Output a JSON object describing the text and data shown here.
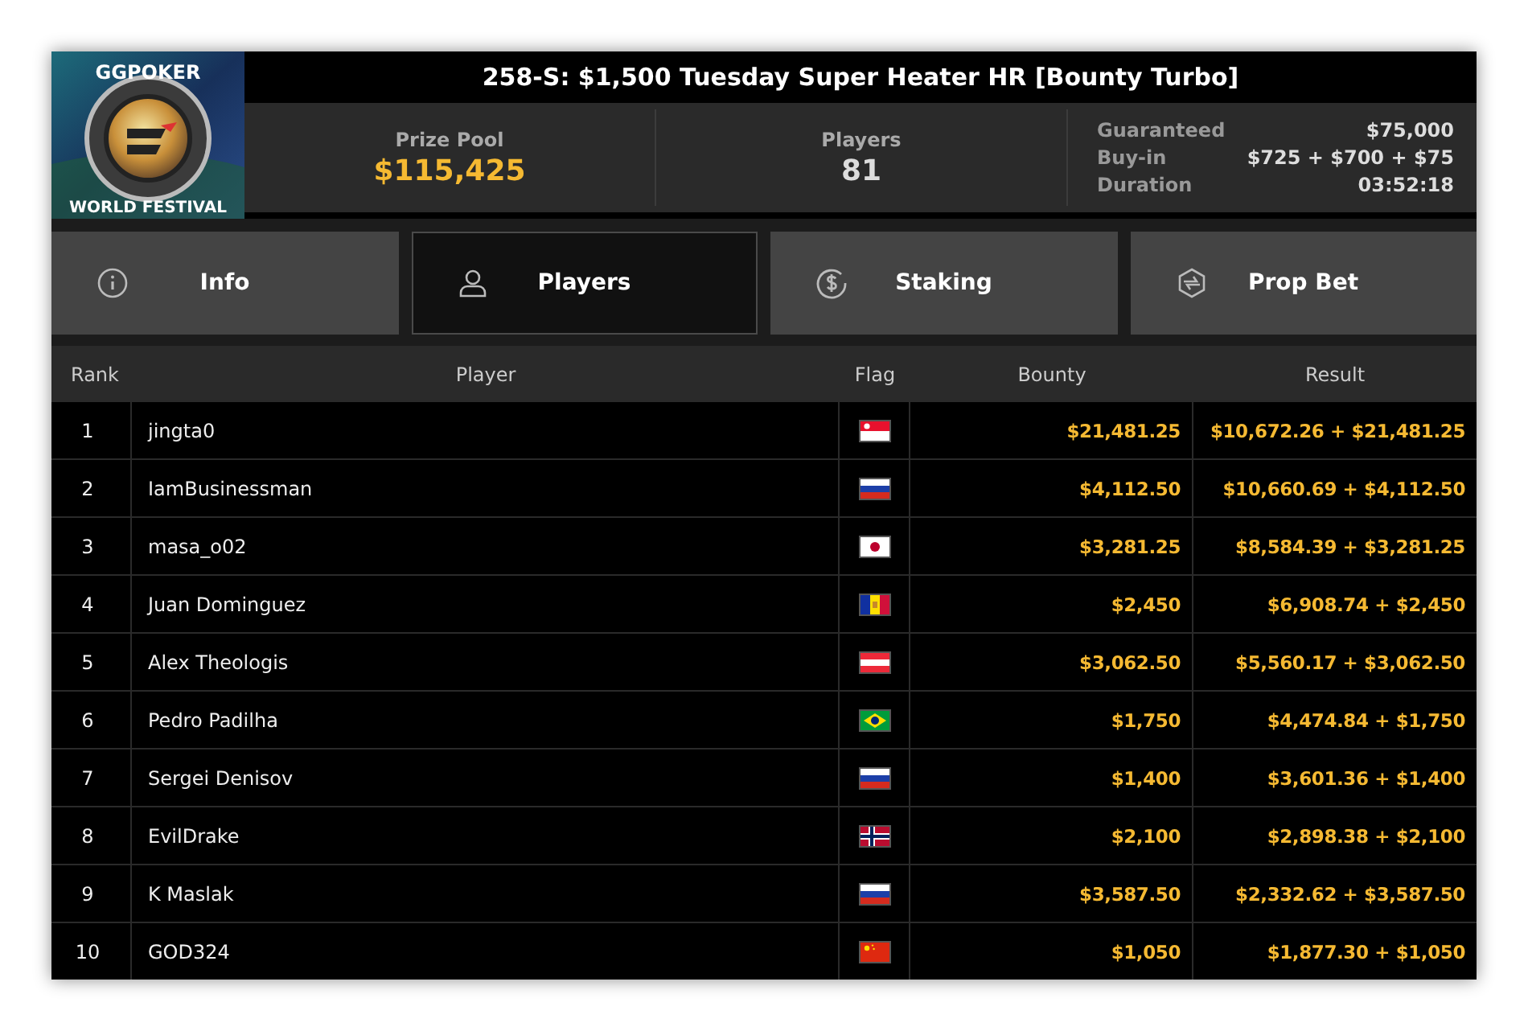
{
  "logo": {
    "top_text": "GGPOKER",
    "bottom_text": "WORLD FESTIVAL"
  },
  "title": "258-S: $1,500 Tuesday Super Heater HR [Bounty Turbo]",
  "stats": [
    {
      "label": "Prize Pool",
      "value": "$115,425",
      "kind": "gold"
    },
    {
      "label": "Players",
      "value": "81",
      "kind": "plain"
    }
  ],
  "details": [
    {
      "label": "Guaranteed",
      "value": "$75,000"
    },
    {
      "label": "Buy-in",
      "value": "$725 + $700 + $75"
    },
    {
      "label": "Duration",
      "value": "03:52:18"
    }
  ],
  "tabs": [
    {
      "label": "Info",
      "kind": "info",
      "selected": false
    },
    {
      "label": "Players",
      "kind": "person",
      "selected": true
    },
    {
      "label": "Staking",
      "kind": "dollar",
      "selected": false
    },
    {
      "label": "Prop Bet",
      "kind": "propbet",
      "selected": false
    }
  ],
  "table": {
    "columns": [
      "Rank",
      "Player",
      "Flag",
      "Bounty",
      "Result"
    ],
    "rows": [
      {
        "rank": "1",
        "player": "jingta0",
        "flag": {
          "kind": "singapore"
        },
        "bounty": "$21,481.25",
        "result": "$10,672.26 + $21,481.25"
      },
      {
        "rank": "2",
        "player": "IamBusinessman",
        "flag": {
          "kind": "russia"
        },
        "bounty": "$4,112.50",
        "result": "$10,660.69 + $4,112.50"
      },
      {
        "rank": "3",
        "player": "masa_o02",
        "flag": {
          "kind": "japan"
        },
        "bounty": "$3,281.25",
        "result": "$8,584.39 + $3,281.25"
      },
      {
        "rank": "4",
        "player": "Juan Dominguez",
        "flag": {
          "kind": "andorra"
        },
        "bounty": "$2,450",
        "result": "$6,908.74 + $2,450"
      },
      {
        "rank": "5",
        "player": "Alex Theologis",
        "flag": {
          "kind": "austria"
        },
        "bounty": "$3,062.50",
        "result": "$5,560.17 + $3,062.50"
      },
      {
        "rank": "6",
        "player": "Pedro Padilha",
        "flag": {
          "kind": "brazil"
        },
        "bounty": "$1,750",
        "result": "$4,474.84 + $1,750"
      },
      {
        "rank": "7",
        "player": "Sergei Denisov",
        "flag": {
          "kind": "russia"
        },
        "bounty": "$1,400",
        "result": "$3,601.36 + $1,400"
      },
      {
        "rank": "8",
        "player": "EvilDrake",
        "flag": {
          "kind": "norway"
        },
        "bounty": "$2,100",
        "result": "$2,898.38 + $2,100"
      },
      {
        "rank": "9",
        "player": "K Maslak",
        "flag": {
          "kind": "russia"
        },
        "bounty": "$3,587.50",
        "result": "$2,332.62 + $3,587.50"
      },
      {
        "rank": "10",
        "player": "GOD324",
        "flag": {
          "kind": "china"
        },
        "bounty": "$1,050",
        "result": "$1,877.30 + $1,050"
      }
    ]
  }
}
